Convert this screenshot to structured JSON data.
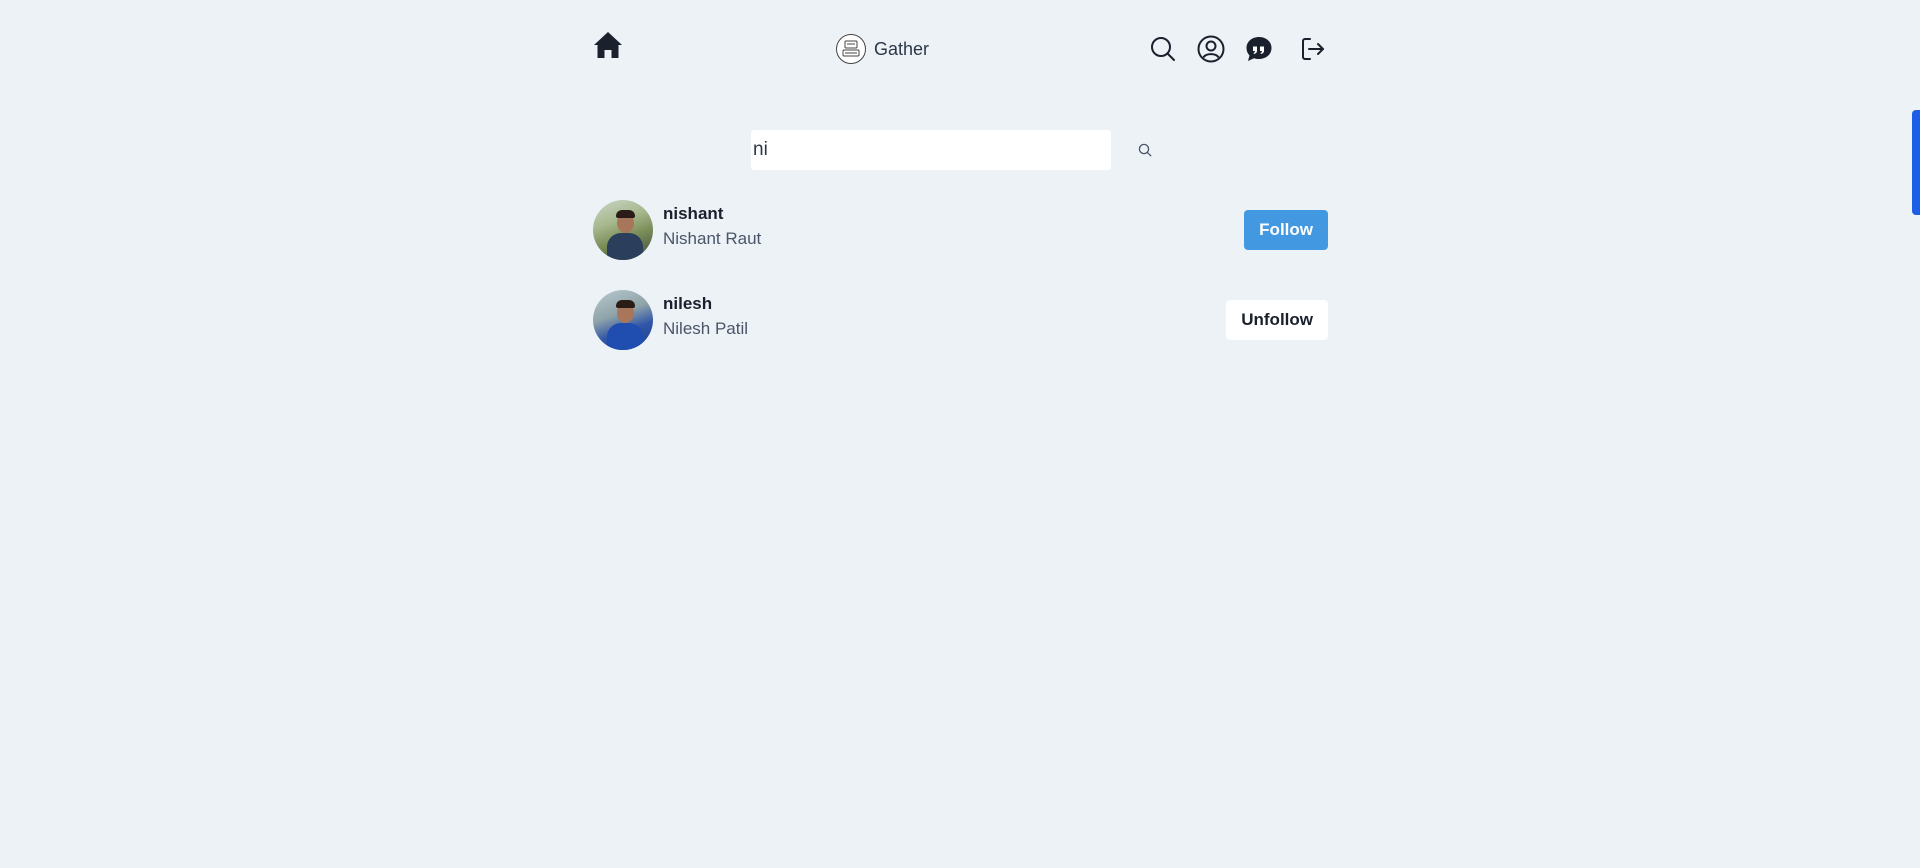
{
  "header": {
    "brand_title": "Gather",
    "icons": [
      "home-icon",
      "app-logo-icon",
      "search-icon",
      "user-circle-icon",
      "quote-chat-icon",
      "logout-icon"
    ]
  },
  "search": {
    "value": "ni",
    "placeholder": ""
  },
  "results": [
    {
      "username": "nishant",
      "full_name": "Nishant Raut",
      "action_label": "Follow"
    },
    {
      "username": "nilesh",
      "full_name": "Nilesh Patil",
      "action_label": "Unfollow"
    }
  ],
  "colors": {
    "background": "#edf2f7",
    "follow_button": "#4299e1",
    "side_tab": "#1d5ee6"
  }
}
